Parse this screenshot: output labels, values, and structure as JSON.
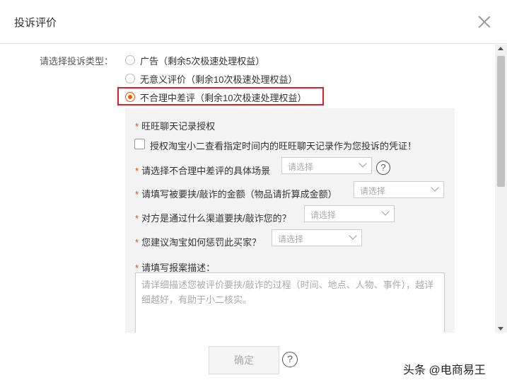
{
  "dialog": {
    "title": "投诉评价"
  },
  "form": {
    "type_label": "请选择投诉类型：",
    "options": [
      {
        "label": "广告（剩余5次极速处理权益）",
        "checked": false
      },
      {
        "label": "无意义评价（剩余10次极速处理权益）",
        "checked": false
      },
      {
        "label": "不合理中差评（剩余10次极速处理权益）",
        "checked": true
      }
    ],
    "chat_auth": {
      "label": "旺旺聊天记录授权",
      "checkbox_text": "授权淘宝小二查看指定时间内的旺旺聊天记录作为您投诉的凭证！"
    },
    "fields": [
      {
        "label": "请选择不合理中差评的具体场景",
        "placeholder": "请选择"
      },
      {
        "label": "请填写被要挟/敲诈的金额（物品请折算成金额）",
        "placeholder": "请选择"
      },
      {
        "label": "对方是通过什么渠道要挟/敲诈您的？",
        "placeholder": "请选择"
      },
      {
        "label": "您建议淘宝如何惩罚此买家？",
        "placeholder": "请选择"
      }
    ],
    "description": {
      "label": "请填写报案描述：",
      "placeholder": "请详细描述您被评价要挟/敲诈的过程（时间、地点、人物、事件），越详细越好，有助于小二核实。"
    }
  },
  "footer": {
    "confirm_label": "确定",
    "help_symbol": "?"
  },
  "watermark": "头条 @电商易王",
  "colors": {
    "accent": "#ff5500",
    "highlight": "#e02020",
    "required": "#ff4400"
  }
}
